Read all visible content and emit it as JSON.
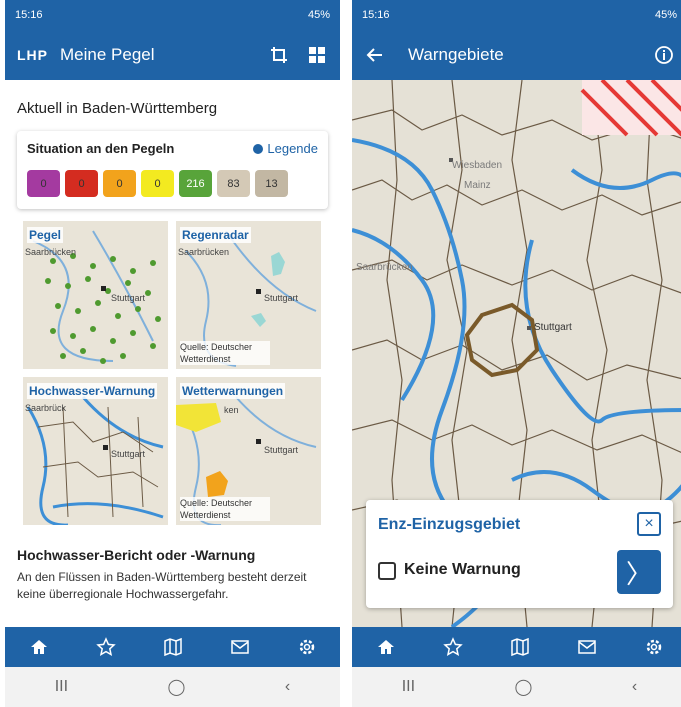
{
  "colors": {
    "primary": "#1f63a6",
    "accent_purple": "#a43aa0",
    "red": "#d42c20",
    "orange": "#f2a31c",
    "yellow": "#f3ea20",
    "green": "#58a43a",
    "beige": "#d4c9b6",
    "greige": "#c2b7a3"
  },
  "screen1": {
    "status": {
      "time": "15:16",
      "signal": "45%"
    },
    "appbar": {
      "logo": "LHP",
      "title": "Meine Pegel",
      "icons": [
        "crop-icon",
        "grid-icon"
      ]
    },
    "section_title": "Aktuell in Baden-Württemberg",
    "situation": {
      "title": "Situation an den Pegeln",
      "legend_label": "Legende",
      "chips": [
        {
          "value": "0",
          "color": "#a43aa0"
        },
        {
          "value": "0",
          "color": "#d42c20"
        },
        {
          "value": "0",
          "color": "#f2a31c"
        },
        {
          "value": "0",
          "color": "#f3ea20"
        },
        {
          "value": "216",
          "color": "#58a43a"
        },
        {
          "value": "83",
          "color": "#d4c9b6"
        },
        {
          "value": "13",
          "color": "#c2b7a3"
        }
      ]
    },
    "tiles": [
      {
        "label": "Pegel",
        "city1": "Saarbrücken",
        "city2": "Stuttgart",
        "source": ""
      },
      {
        "label": "Regenradar",
        "city1": "Saarbrücken",
        "city2": "Stuttgart",
        "source": "Quelle: Deutscher Wetterdienst"
      },
      {
        "label": "Hochwasser-Warnung",
        "city1": "Saarbrück",
        "city2": "Stuttgart",
        "source": ""
      },
      {
        "label": "Wetterwarnungen",
        "city1": "ken",
        "city2": "Stuttgart",
        "source": "Quelle: Deutscher Wetterdienst"
      }
    ],
    "report": {
      "title": "Hochwasser-Bericht oder -Warnung",
      "text": "An den Flüssen in Baden-Württemberg besteht derzeit keine überregionale Hochwassergefahr."
    },
    "bottom_nav": [
      "home-icon",
      "star-icon",
      "map-icon",
      "mail-icon",
      "settings-icon"
    ]
  },
  "screen2": {
    "status": {
      "time": "15:16",
      "signal": "45%"
    },
    "appbar": {
      "title": "Warngebiete"
    },
    "map_labels": {
      "wiesbaden": "Wiesbaden",
      "mainz": "Mainz",
      "saarbruecken": "Saarbrücken",
      "stuttgart": "Stuttgart"
    },
    "popup": {
      "title": "Enz-Einzugsgebiet",
      "checkbox_label": "Keine Warnung",
      "close": "×",
      "go": "〉"
    }
  },
  "sysnav": {
    "recents": "III",
    "home": "◯",
    "back": "‹"
  }
}
